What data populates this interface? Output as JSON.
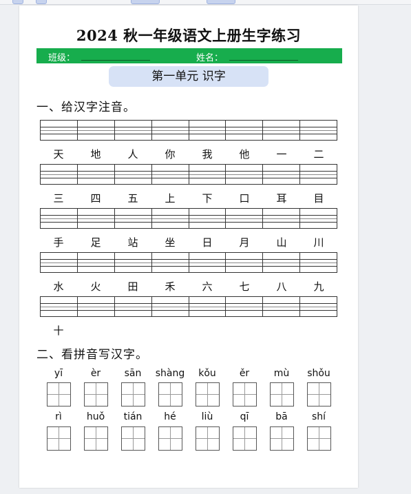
{
  "doc": {
    "title": "2024 秋一年级语文上册生字练习",
    "class_label": "班级：",
    "name_label": "姓名：",
    "unit_title": "第一单元 识字"
  },
  "section1": {
    "heading": "一、给汉字注音。",
    "rows": [
      [
        "天",
        "地",
        "人",
        "你",
        "我",
        "他",
        "一",
        "二"
      ],
      [
        "三",
        "四",
        "五",
        "上",
        "下",
        "口",
        "耳",
        "目"
      ],
      [
        "手",
        "足",
        "站",
        "坐",
        "日",
        "月",
        "山",
        "川"
      ],
      [
        "水",
        "火",
        "田",
        "禾",
        "六",
        "七",
        "八",
        "九"
      ],
      [
        "十"
      ]
    ]
  },
  "section2": {
    "heading": "二、看拼音写汉字。",
    "rows": [
      [
        "yī",
        "èr",
        "sān",
        "shàng",
        "kǒu",
        "ěr",
        "mù",
        "shǒu"
      ],
      [
        "rì",
        "huǒ",
        "tián",
        "hé",
        "liù",
        "qī",
        "bā",
        "shí"
      ]
    ]
  }
}
